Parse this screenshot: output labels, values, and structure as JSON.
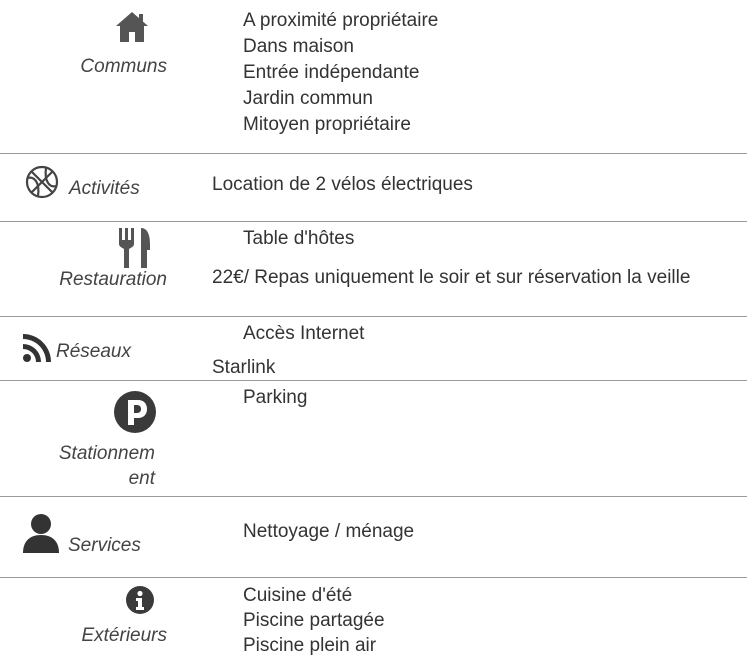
{
  "sections": [
    {
      "category": "Communs",
      "icon": "home-icon",
      "items": [
        "A proximité propriétaire",
        "Dans maison",
        "Entrée indépendante",
        "Jardin commun",
        "Mitoyen propriétaire"
      ]
    },
    {
      "category": "Activités",
      "icon": "basketball-icon",
      "note": "Location de 2 vélos électriques"
    },
    {
      "category": "Restauration",
      "icon": "utensils-icon",
      "items": [
        "Table d'hôtes"
      ],
      "note": "22€/ Repas uniquement le soir et sur réservation la veille"
    },
    {
      "category": "Réseaux",
      "icon": "rss-icon",
      "items": [
        "Accès Internet"
      ],
      "note": "Starlink"
    },
    {
      "category": "Stationnement",
      "category_line1": "Stationnem",
      "category_line2": "ent",
      "icon": "parking-icon",
      "items": [
        "Parking"
      ]
    },
    {
      "category": "Services",
      "icon": "user-icon",
      "items": [
        "Nettoyage / ménage"
      ]
    },
    {
      "category": "Extérieurs",
      "icon": "info-icon",
      "items": [
        "Cuisine d'été",
        "Piscine partagée",
        "Piscine plein air"
      ]
    }
  ],
  "colors": {
    "icon": "#555555",
    "text": "#333333",
    "separator": "#9a9a9a"
  }
}
